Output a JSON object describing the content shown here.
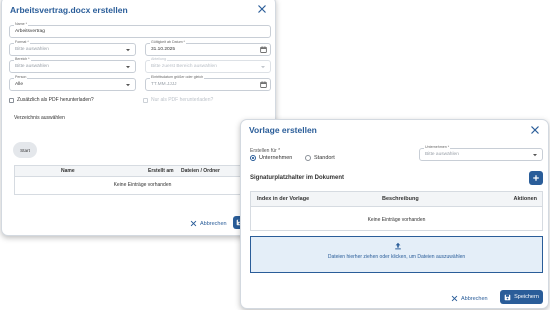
{
  "colors": {
    "accent": "#2a5d99",
    "dropzone_bg": "#e4eef8",
    "header_bg": "#f3f5f7"
  },
  "back_dialog": {
    "title": "Arbeitsvertrag.docx erstellen",
    "name_field": {
      "label": "Name *",
      "value": "Arbeitsvertrag"
    },
    "format_field": {
      "label": "Format *",
      "placeholder": "Bitte auswählen"
    },
    "valid_from_field": {
      "label": "Gültigkeit ab Datum *",
      "value": "31.10.2025"
    },
    "division_field": {
      "label": "Bereich *",
      "placeholder": "Bitte auswählen"
    },
    "department_field": {
      "label": "Abteilung",
      "placeholder": "Bitte zuerst Bereich auswählen"
    },
    "people_field": {
      "label": "Person",
      "value": "Alle"
    },
    "entry_date_field": {
      "label": "Eintrittsdatum größer oder gleich",
      "placeholder": "TT.MM.JJJJ"
    },
    "pdf_checkbox_label": "Zusätzlich als PDF herunterladen?",
    "pdf_only_checkbox_label": "Nur als PDF herunterladen?",
    "directory_label": "Verzeichnis auswählen",
    "start_chip": "Start",
    "table": {
      "columns": [
        "Name",
        "Erstellt am",
        "Dateien / Ordner"
      ],
      "empty_text": "Keine Einträge vorhanden"
    },
    "cancel_label": "Abbrechen"
  },
  "front_dialog": {
    "title": "Vorlage erstellen",
    "create_for_label": "Erstellen für *",
    "options": [
      "Unternehmen",
      "Standort"
    ],
    "selected_option": "Unternehmen",
    "company_field": {
      "label": "Unternehmen *",
      "placeholder": "Bitte auswählen"
    },
    "section_title": "Signaturplatzhalter im Dokument",
    "table": {
      "columns": [
        "Index in der Vorlage",
        "Beschreibung",
        "Aktionen"
      ],
      "empty_text": "Keine Einträge vorhanden"
    },
    "dropzone_text": "Dateien hierher ziehen oder klicken, um Dateien auszuwählen",
    "cancel_label": "Abbrechen",
    "save_label": "Speichern"
  }
}
